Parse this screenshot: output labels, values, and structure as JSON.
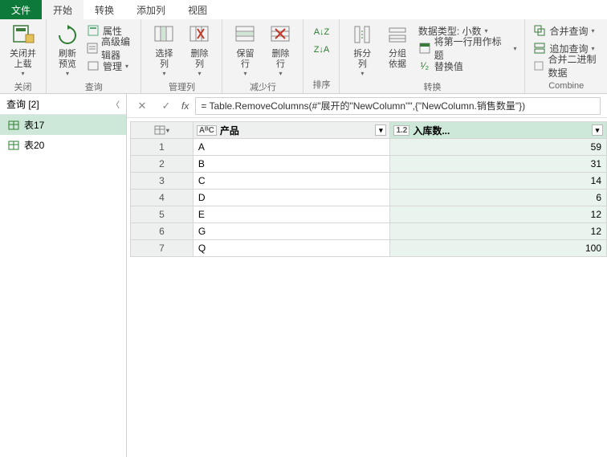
{
  "tabs": {
    "file": "文件",
    "home": "开始",
    "transform": "转换",
    "addcol": "添加列",
    "view": "视图"
  },
  "ribbon": {
    "close": {
      "btn": "关闭并\n上载",
      "group": "关闭"
    },
    "query": {
      "refresh": "刷新\n预览",
      "props": "属性",
      "adv": "高级编辑器",
      "manage": "管理",
      "group": "查询"
    },
    "cols": {
      "choose": "选择\n列",
      "remove": "删除\n列",
      "group": "管理列"
    },
    "rows": {
      "keep": "保留\n行",
      "remove": "删除\n行",
      "group": "减少行"
    },
    "sort": {
      "group": "排序"
    },
    "transform": {
      "split": "拆分\n列",
      "groupby": "分组\n依据",
      "dtype": "数据类型: 小数",
      "firstrow": "将第一行用作标题",
      "replace": "替换值",
      "group": "转换"
    },
    "combine": {
      "merge": "合并查询",
      "append": "追加查询",
      "binary": "合并二进制数据",
      "group": "Combine"
    }
  },
  "queries": {
    "title": "查询 [2]",
    "items": [
      "表17",
      "表20"
    ]
  },
  "fx": {
    "formula": "= Table.RemoveColumns(#\"展开的\"NewColumn\"\",{\"NewColumn.销售数量\"})"
  },
  "grid": {
    "col1": {
      "type": "AᴮC",
      "name": "产品"
    },
    "col2": {
      "type": "1.2",
      "name": "入库数..."
    },
    "rows": [
      {
        "n": "1",
        "p": "A",
        "v": "59"
      },
      {
        "n": "2",
        "p": "B",
        "v": "31"
      },
      {
        "n": "3",
        "p": "C",
        "v": "14"
      },
      {
        "n": "4",
        "p": "D",
        "v": "6"
      },
      {
        "n": "5",
        "p": "E",
        "v": "12"
      },
      {
        "n": "6",
        "p": "G",
        "v": "12"
      },
      {
        "n": "7",
        "p": "Q",
        "v": "100"
      }
    ]
  }
}
